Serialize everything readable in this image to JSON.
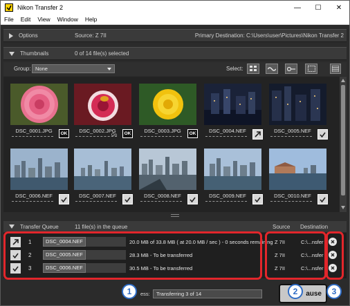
{
  "window": {
    "title": "Nikon Transfer 2"
  },
  "menu": [
    "File",
    "Edit",
    "View",
    "Window",
    "Help"
  ],
  "options": {
    "label": "Options",
    "source": "Source: Z 7II",
    "destination": "Primary Destination: C:\\Users\\user\\Pictures\\Nikon Transfer 2"
  },
  "thumbnails": {
    "label": "Thumbnails",
    "selected": "0 of 14 file(s) selected",
    "group_label": "Group:",
    "group_value": "None",
    "select_label": "Select:",
    "items": [
      {
        "name": "DSC_0001.JPG",
        "badge": "ok",
        "badge_text": "OK"
      },
      {
        "name": "DSC_0002.JPG",
        "badge": "ok",
        "badge_text": "OK",
        "key_icon": "On"
      },
      {
        "name": "DSC_0003.JPG",
        "badge": "ok",
        "badge_text": "OK"
      },
      {
        "name": "DSC_0004.NEF",
        "badge": "transfer"
      },
      {
        "name": "DSC_0005.NEF",
        "badge": "check"
      },
      {
        "name": "DSC_0006.NEF",
        "badge": "check"
      },
      {
        "name": "DSC_0007.NEF",
        "badge": "check"
      },
      {
        "name": "DSC_0008.NEF",
        "badge": "check"
      },
      {
        "name": "DSC_0009.NEF",
        "badge": "check"
      },
      {
        "name": "DSC_0010.NEF",
        "badge": "check"
      }
    ]
  },
  "queue": {
    "label": "Transfer Queue",
    "count": "11 file(s) in the queue",
    "col_source": "Source",
    "col_destination": "Destination",
    "rows": [
      {
        "num": "1",
        "file": "DSC_0004.NEF",
        "status": "20.0 MB of 33.8 MB ( at 20.0 MB / sec ) - 0 seconds remaining",
        "source": "Z 7II",
        "destination": "C:\\...nsfer",
        "icon": "transfer"
      },
      {
        "num": "2",
        "file": "DSC_0005.NEF",
        "status": "28.3 MB - To be transferred",
        "source": "Z 7II",
        "destination": "C:\\...nsfer",
        "icon": "check"
      },
      {
        "num": "3",
        "file": "DSC_0006.NEF",
        "status": "30.5 MB - To be transferred",
        "source": "Z 7II",
        "destination": "C:\\...nsfer",
        "icon": "check"
      }
    ]
  },
  "bottom": {
    "progress_label": "ess:",
    "progress_text": "Transferring 3 of 14",
    "pause_label": "ause"
  },
  "callouts": [
    "1",
    "2",
    "3"
  ],
  "colors": {
    "highlight": "#e2262b",
    "callout": "#2f6dc6"
  }
}
